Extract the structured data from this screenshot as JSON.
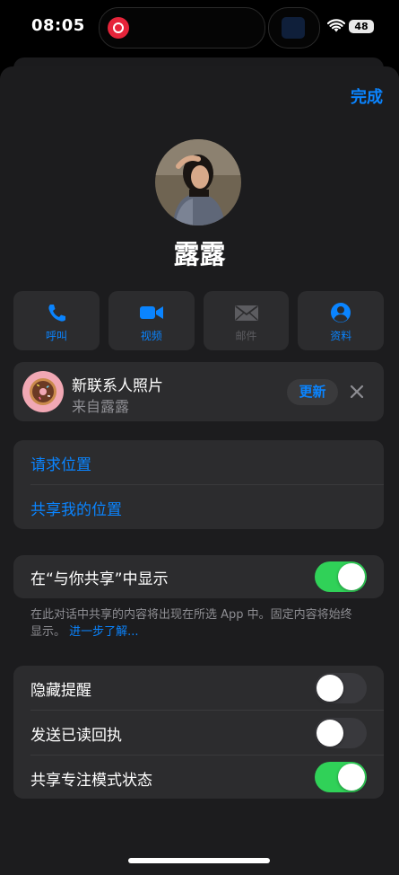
{
  "status_bar": {
    "time": "08:05",
    "battery": "48"
  },
  "header": {
    "done_label": "完成"
  },
  "contact": {
    "name": "露露"
  },
  "actions": [
    {
      "label": "呼叫",
      "icon": "phone-icon",
      "enabled": true
    },
    {
      "label": "视频",
      "icon": "video-camera-icon",
      "enabled": true
    },
    {
      "label": "邮件",
      "icon": "mail-icon",
      "enabled": false
    },
    {
      "label": "资料",
      "icon": "person-circle-icon",
      "enabled": true
    }
  ],
  "photo_update": {
    "title": "新联系人照片",
    "subtitle": "来自露露",
    "update_label": "更新"
  },
  "location": {
    "request_label": "请求位置",
    "share_label": "共享我的位置"
  },
  "shared_with_you": {
    "label": "在“与你共享”中显示",
    "enabled": true,
    "note": "在此对话中共享的内容将出现在所选 App 中。固定内容将始终显示。",
    "learn_more": "进一步了解..."
  },
  "toggles": [
    {
      "label": "隐藏提醒",
      "enabled": false
    },
    {
      "label": "发送已读回执",
      "enabled": false
    },
    {
      "label": "共享专注模式状态",
      "enabled": true
    }
  ],
  "colors": {
    "accent": "#0a84ff",
    "toggle_on": "#30d158",
    "sheet_bg": "#1c1c1e",
    "card_bg": "#2c2c2e"
  }
}
